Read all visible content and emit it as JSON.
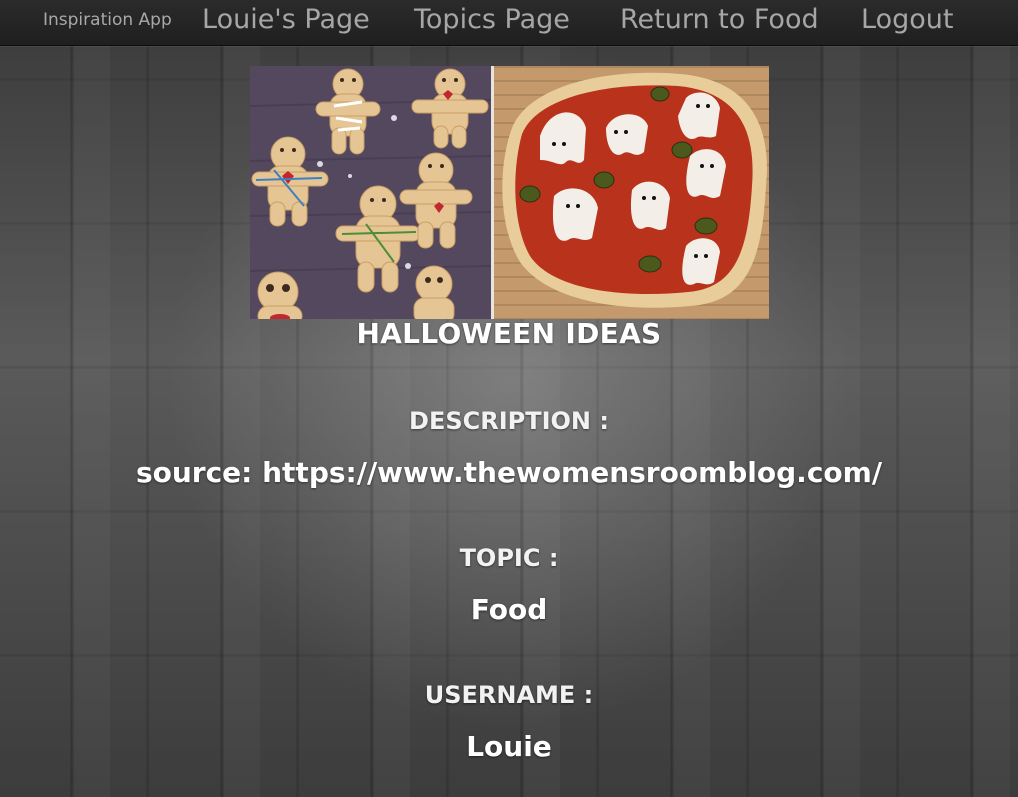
{
  "nav": {
    "brand": "Inspiration App",
    "links": [
      "Louie's Page",
      "Topics Page",
      "Return to Food",
      "Logout"
    ]
  },
  "post": {
    "title": "HALLOWEEN IDEAS",
    "description_label": "DESCRIPTION :",
    "description": "source: https://www.thewomensroomblog.com/",
    "topic_label": "TOPIC :",
    "topic": "Food",
    "username_label": "USERNAME :",
    "username": "Louie"
  },
  "image": {
    "alt": "Halloween voodoo cookies and ghost pizza",
    "left_panel_color": "#54485f",
    "crust_color": "#e8cc9a",
    "sauce_color": "#b8321c"
  }
}
